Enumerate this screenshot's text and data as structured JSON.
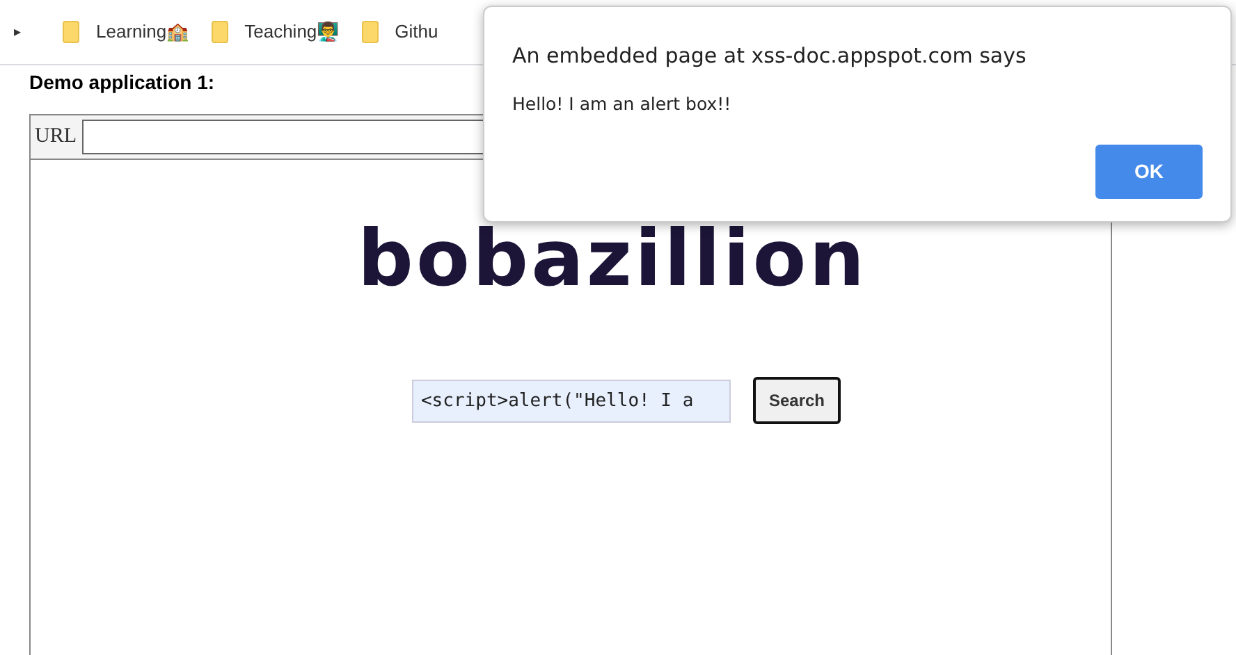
{
  "bookmarks_chevron": "▸",
  "bookmarks": [
    {
      "label": "Learning",
      "emoji": "🏫"
    },
    {
      "label": "Teaching",
      "emoji": "👨‍🏫"
    },
    {
      "label": "Githu"
    }
  ],
  "page": {
    "heading": "Demo application 1:",
    "url_label": "URL",
    "logo": "bobazillion",
    "search_value": "<script>alert(\"Hello! I a",
    "search_button": "Search"
  },
  "dialog": {
    "title": "An embedded page at xss-doc.appspot.com says",
    "message": "Hello! I am an alert box!!",
    "button": "OK"
  }
}
